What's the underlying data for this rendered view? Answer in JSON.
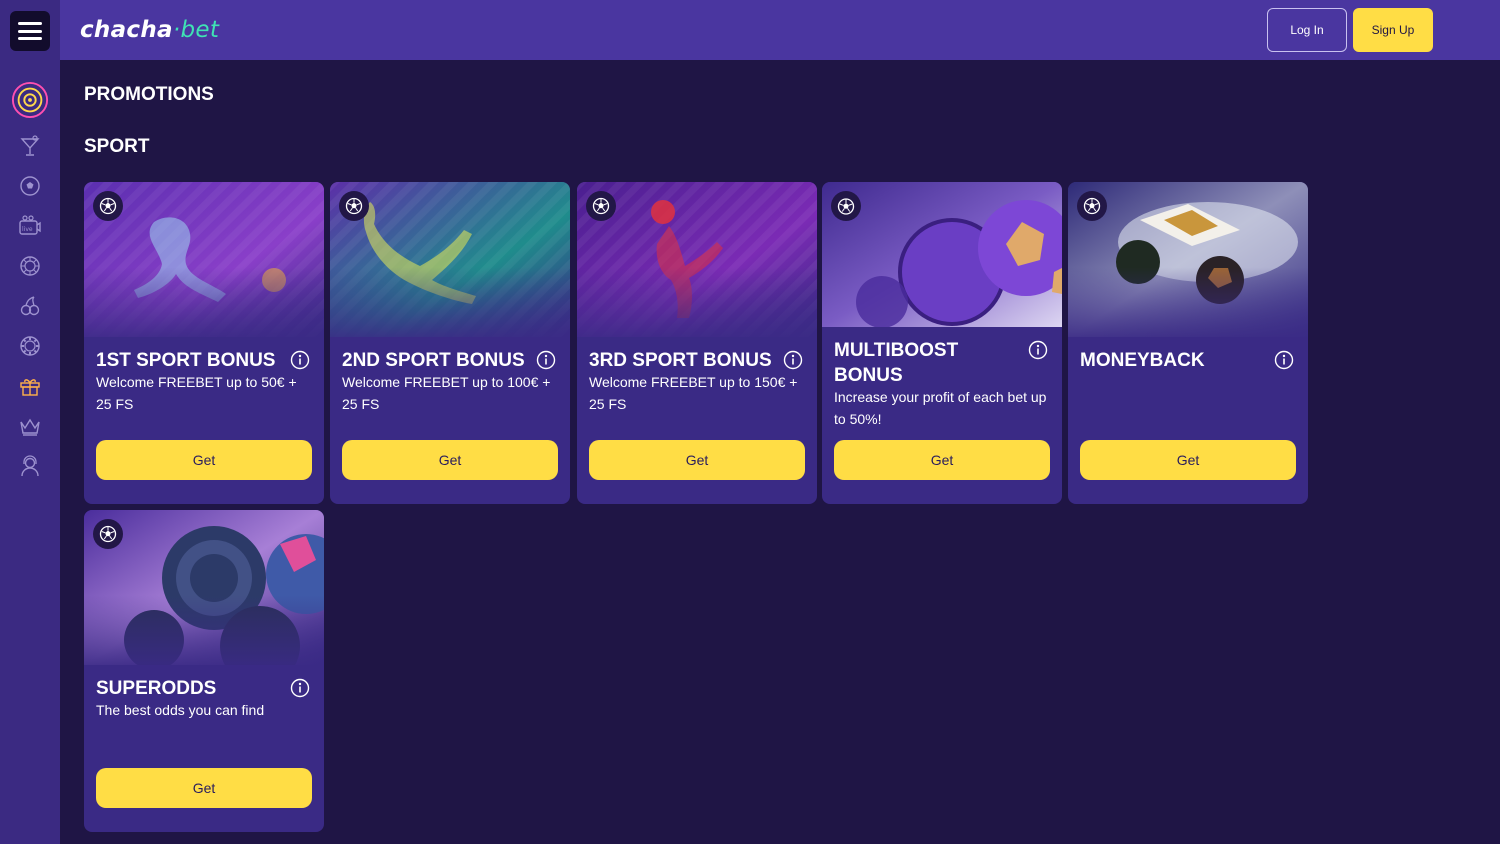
{
  "header": {
    "logo_part1": "chacha",
    "logo_part2": "·bet",
    "login_label": "Log In",
    "signup_label": "Sign Up"
  },
  "sidebar": {
    "icons": [
      "target-icon",
      "cocktail-icon",
      "soccer-ball-icon",
      "live-tv-icon",
      "roulette-icon",
      "cherries-icon",
      "poker-chip-icon",
      "gift-icon",
      "crown-icon",
      "support-agent-icon"
    ]
  },
  "page": {
    "title": "PROMOTIONS",
    "section": "SPORT"
  },
  "promotions": [
    {
      "title": "1ST SPORT BONUS",
      "description": "Welcome FREEBET up to 50€ + 25 FS",
      "button": "Get"
    },
    {
      "title": "2ND SPORT BONUS",
      "description": "Welcome FREEBET up to 100€ + 25 FS",
      "button": "Get"
    },
    {
      "title": "3RD SPORT BONUS",
      "description": "Welcome FREEBET up to 150€ + 25 FS",
      "button": "Get"
    },
    {
      "title": "MULTIBOOST BONUS",
      "description": "Increase your profit of each bet up to 50%!",
      "button": "Get"
    },
    {
      "title": "MONEYBACK",
      "description": "",
      "button": "Get"
    },
    {
      "title": "SUPERODDS",
      "description": "The best odds you can find",
      "button": "Get"
    }
  ],
  "colors": {
    "background": "#1f1545",
    "sidebar": "#3b2a82",
    "header": "#4a36a0",
    "card": "#3a2a85",
    "accent_yellow": "#ffdd45",
    "logo_green": "#3fe3b4"
  }
}
